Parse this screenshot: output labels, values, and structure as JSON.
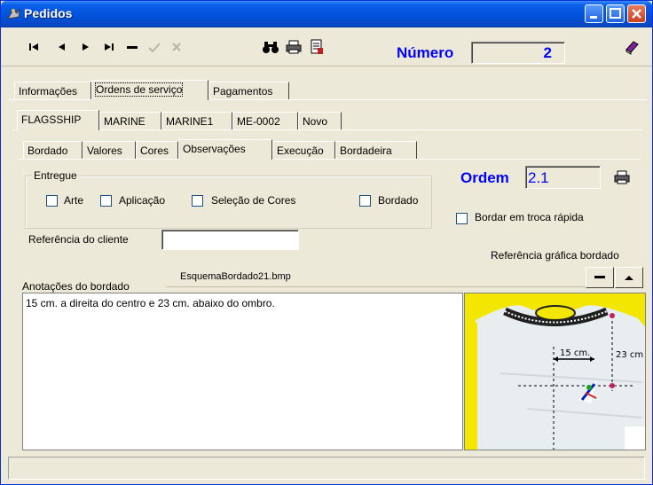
{
  "window": {
    "title": "Pedidos",
    "colors": {
      "titlebar": "#0250d8",
      "accent": "#0000ff",
      "face": "#ece9d8"
    }
  },
  "toolbar": {
    "icons": [
      "first-record-icon",
      "prev-record-icon",
      "next-record-icon",
      "last-record-icon",
      "delete-record-icon",
      "confirm-icon",
      "cancel-icon",
      "binoculars-icon",
      "printer-icon",
      "export-icon",
      "book-icon"
    ],
    "numero_label": "Número",
    "numero_value": "2"
  },
  "tabs_main": [
    "Informações",
    "Ordens de serviço",
    "Pagamentos"
  ],
  "tabs_orders": [
    "FLAGSSHIP",
    "MARINE",
    "MARINE1",
    "ME-0002",
    "Novo"
  ],
  "tabs_detail": [
    "Bordado",
    "Valores",
    "Cores",
    "Observações",
    "Execução",
    "Bordadeira"
  ],
  "entregue": {
    "title": "Entregue",
    "items": [
      "Arte",
      "Aplicação",
      "Seleção de Cores",
      "Bordado"
    ]
  },
  "ordem": {
    "label": "Ordem",
    "value": "2.1"
  },
  "troca_rapida_label": "Bordar em troca rápida",
  "referencia_cliente": {
    "label": "Referência do cliente",
    "value": ""
  },
  "referencia_grafica_label": "Referência gráfica bordado",
  "file_name": "EsquemaBordado21.bmp",
  "anotacoes": {
    "label": "Anotações do bordado",
    "text": "15 cm. a direita do centro e 23 cm. abaixo do ombro."
  },
  "image_labels": {
    "horizontal": "15 cm.",
    "vertical": "23 cm"
  },
  "status_text": ""
}
